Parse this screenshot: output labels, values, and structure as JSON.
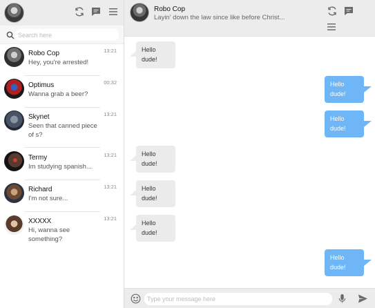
{
  "sidebar": {
    "search": {
      "placeholder": "Search here"
    },
    "contacts": [
      {
        "name": "Robo Cop",
        "message": "Hey, you're arrested!",
        "time": "13:21"
      },
      {
        "name": "Optimus",
        "message": "Wanna grab a beer?",
        "time": "00:32"
      },
      {
        "name": "Skynet",
        "message": "Seen that canned piece of s?",
        "time": "13:21"
      },
      {
        "name": "Termy",
        "message": "Im studying spanish...",
        "time": "13:21"
      },
      {
        "name": "Richard",
        "message": "I'm not sure...",
        "time": "13:21"
      },
      {
        "name": "XXXXX",
        "message": "Hi, wanna see something?",
        "time": "13:21"
      }
    ]
  },
  "chat": {
    "name": "Robo Cop",
    "status": "Layin' down the law since like before Christ...",
    "messages": [
      {
        "direction": "in",
        "text": "Hello dude!"
      },
      {
        "direction": "out",
        "text": "Hello dude!"
      },
      {
        "direction": "out",
        "text": "Hello dude!"
      },
      {
        "direction": "in",
        "text": "Hello dude!"
      },
      {
        "direction": "in",
        "text": "Hello dude!"
      },
      {
        "direction": "in",
        "text": "Hello dude!"
      },
      {
        "direction": "out",
        "text": "Hello dude!"
      }
    ],
    "compose": {
      "placeholder": "Type your message here"
    }
  },
  "icons": {
    "header": [
      "refresh-icon",
      "message-icon",
      "menu-icon"
    ],
    "compose": [
      "emoji-icon",
      "microphone-icon",
      "send-icon"
    ]
  },
  "colors": {
    "outgoing_bubble": "#6eb6f6",
    "incoming_bubble": "#ebebeb",
    "header_bg": "#ececec"
  }
}
